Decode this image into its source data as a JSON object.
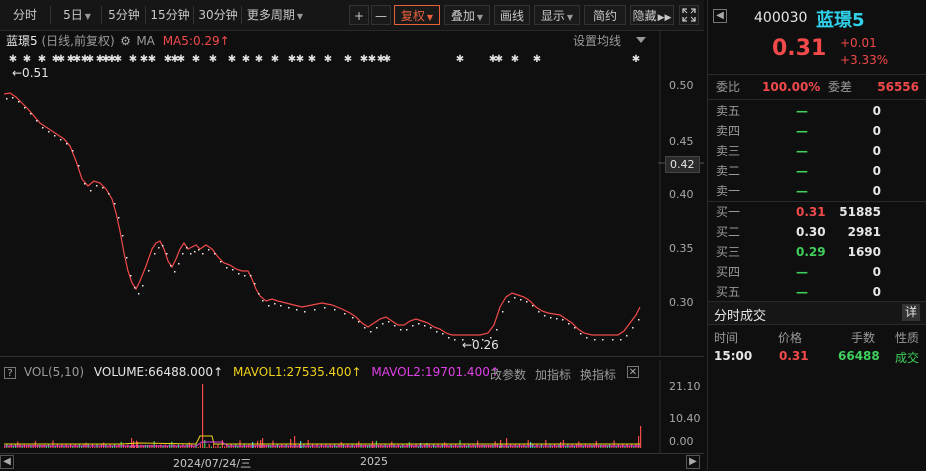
{
  "toolbar": {
    "items": [
      "分时",
      "5日",
      "5分钟",
      "15分钟",
      "30分钟",
      "更多周期",
      "+",
      "—",
      "复权",
      "叠加",
      "画线",
      "显示",
      "简约",
      "隐藏"
    ],
    "expand_icon": "expand-icon"
  },
  "chart": {
    "title": "蓝璟5",
    "mode": "(日线,前复权)",
    "ma_label": "MA",
    "ma5_label": "MA5:0.29",
    "ma_setting": "设置均线",
    "high_marker": "←0.51",
    "low_marker": "←0.26",
    "current_price_box": "0.42",
    "y_ticks": [
      "0.50",
      "0.45",
      "0.40",
      "0.35",
      "0.30"
    ],
    "x_ticks": [
      "2024/07/24/三",
      "2025"
    ],
    "colors": {
      "price_line": "#f24a4a",
      "ma_line": "#f0f0f0",
      "accent": "#e8603c"
    }
  },
  "volume": {
    "title": "VOL(5,10)",
    "volume_label": "VOLUME:66488.000",
    "mavol1_label": "MAVOL1:27535.400",
    "mavol2_label": "MAVOL2:19701.400",
    "buttons": [
      "改参数",
      "加指标",
      "换指标"
    ],
    "y_ticks": [
      "21.10",
      "10.40",
      "0.00"
    ]
  },
  "quote": {
    "code": "400030",
    "name": "蓝璟5",
    "price": "0.31",
    "change": "+0.01",
    "change_pct": "+3.33%",
    "weibi_label": "委比",
    "weibi_value": "100.00%",
    "weicha_label": "委差",
    "weicha_value": "56556"
  },
  "order_book": {
    "asks": [
      {
        "label": "卖五",
        "price": "—",
        "vol": "0"
      },
      {
        "label": "卖四",
        "price": "—",
        "vol": "0"
      },
      {
        "label": "卖三",
        "price": "—",
        "vol": "0"
      },
      {
        "label": "卖二",
        "price": "—",
        "vol": "0"
      },
      {
        "label": "卖一",
        "price": "—",
        "vol": "0"
      }
    ],
    "bids": [
      {
        "label": "买一",
        "price": "0.31",
        "vol": "51885"
      },
      {
        "label": "买二",
        "price": "0.30",
        "vol": "2981"
      },
      {
        "label": "买三",
        "price": "0.29",
        "vol": "1690"
      },
      {
        "label": "买四",
        "price": "—",
        "vol": "0"
      },
      {
        "label": "买五",
        "price": "—",
        "vol": "0"
      }
    ]
  },
  "trades": {
    "title": "分时成交",
    "detail_button": "详",
    "headers": [
      "时间",
      "价格",
      "手数",
      "性质"
    ],
    "rows": [
      {
        "time": "15:00",
        "price": "0.31",
        "qty": "66488",
        "type": "成交"
      }
    ]
  }
}
